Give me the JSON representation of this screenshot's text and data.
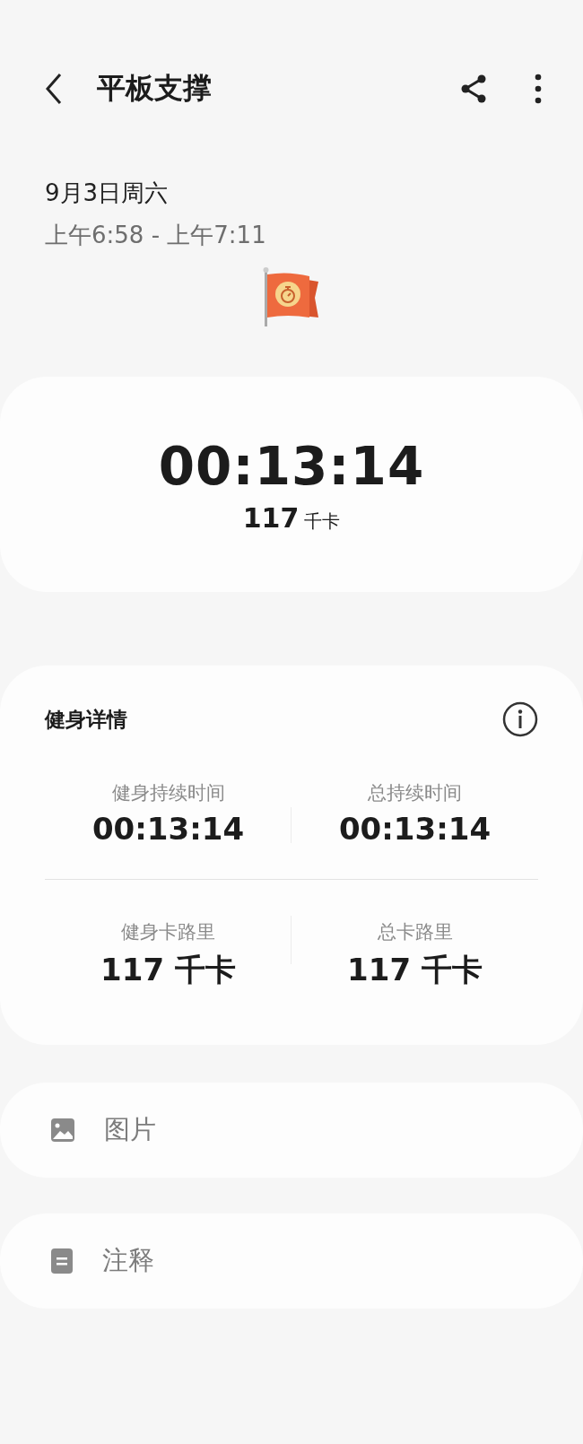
{
  "header": {
    "title": "平板支撑"
  },
  "session": {
    "date": "9月3日周六",
    "time_range": "上午6:58 - 上午7:11"
  },
  "summary": {
    "duration": "00:13:14",
    "calories_value": "117",
    "calories_unit": "千卡"
  },
  "details": {
    "title": "健身详情",
    "stats": [
      {
        "label": "健身持续时间",
        "value": "00:13:14"
      },
      {
        "label": "总持续时间",
        "value": "00:13:14"
      },
      {
        "label": "健身卡路里",
        "value": "117 千卡"
      },
      {
        "label": "总卡路里",
        "value": "117 千卡"
      }
    ]
  },
  "attachments": [
    {
      "kind": "picture",
      "label": "图片"
    },
    {
      "kind": "note",
      "label": "注释"
    }
  ]
}
